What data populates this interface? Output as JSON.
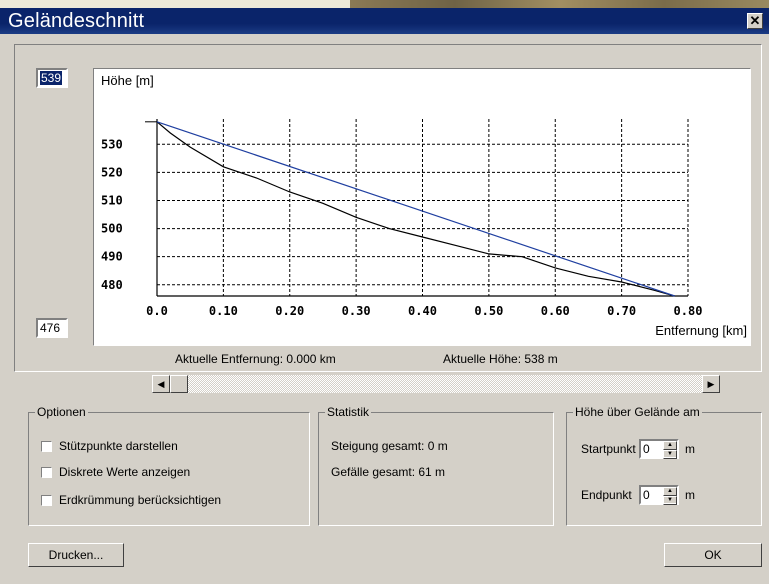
{
  "window": {
    "title": "Geländeschnitt",
    "close_symbol": "✕"
  },
  "chart": {
    "y_max_input": "539",
    "y_min_input": "476",
    "ylabel": "Höhe [m]",
    "xlabel": "Entfernung [km]",
    "info_distance": "Aktuelle Entfernung: 0.000 km",
    "info_height": "Aktuelle Höhe: 538 m"
  },
  "chart_data": {
    "type": "line",
    "xlabel": "Entfernung [km]",
    "ylabel": "Höhe [m]",
    "xlim": [
      0,
      0.8
    ],
    "ylim": [
      476,
      539
    ],
    "x_ticks": [
      "0.0",
      "0.10",
      "0.20",
      "0.30",
      "0.40",
      "0.50",
      "0.60",
      "0.70",
      "0.80"
    ],
    "y_ticks": [
      "480",
      "490",
      "500",
      "510",
      "520",
      "530"
    ],
    "grid": true,
    "series": [
      {
        "color": "#000000",
        "x": [
          0.0,
          0.02,
          0.05,
          0.1,
          0.15,
          0.2,
          0.25,
          0.3,
          0.35,
          0.4,
          0.45,
          0.5,
          0.55,
          0.6,
          0.65,
          0.7,
          0.75,
          0.78
        ],
        "y": [
          538,
          534,
          529,
          522,
          518,
          513,
          509,
          504,
          500,
          497,
          494,
          491,
          490,
          486,
          483,
          481,
          478,
          476
        ]
      },
      {
        "color": "#1f3fa0",
        "x": [
          0.0,
          0.78
        ],
        "y": [
          538,
          476
        ]
      }
    ]
  },
  "options": {
    "title": "Optionen",
    "items": [
      "Stützpunkte darstellen",
      "Diskrete Werte anzeigen",
      "Erdkrümmung berücksichtigen"
    ]
  },
  "stats": {
    "title": "Statistik",
    "ascent": "Steigung gesamt: 0 m",
    "descent": "Gefälle gesamt: 61 m"
  },
  "height": {
    "title": "Höhe über Gelände am",
    "start_label": "Startpunkt",
    "start_value": "0",
    "end_label": "Endpunkt",
    "end_value": "0",
    "unit": "m"
  },
  "buttons": {
    "print": "Drucken...",
    "ok": "OK"
  }
}
